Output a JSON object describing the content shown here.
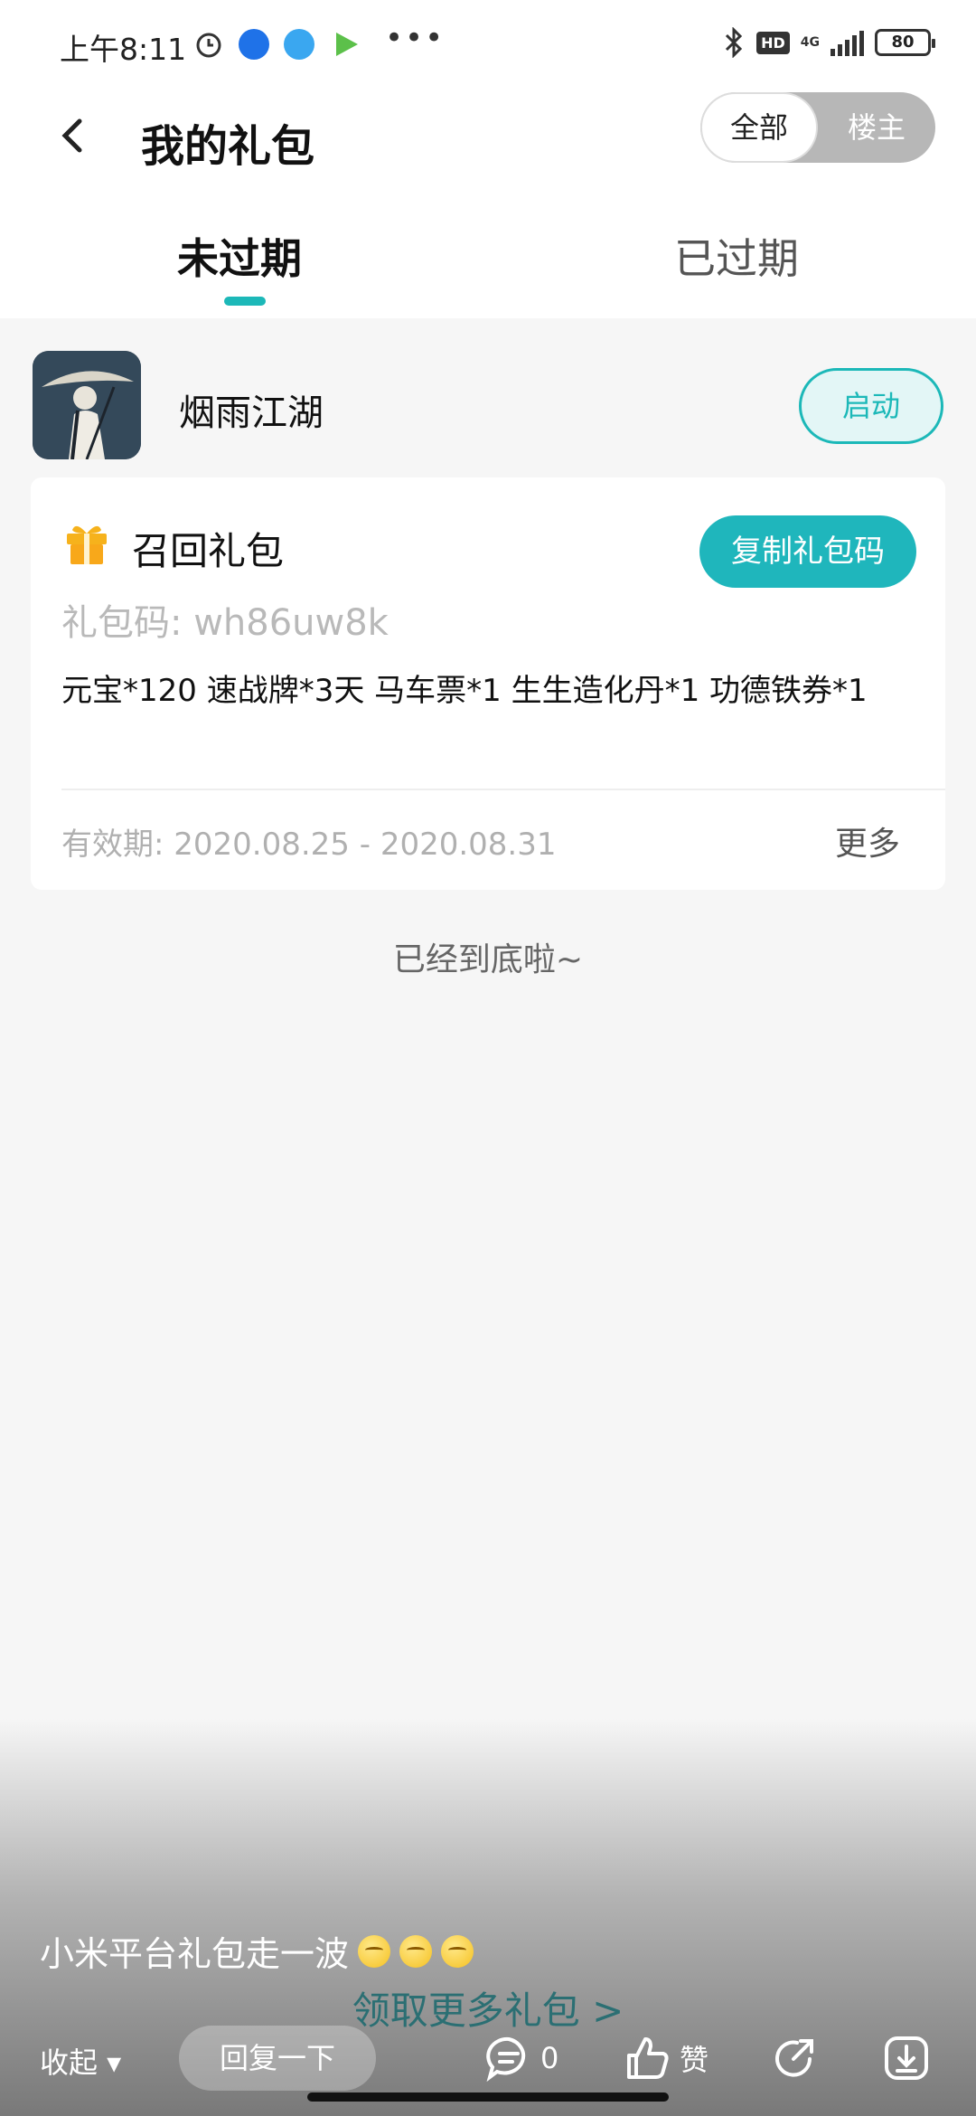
{
  "status_bar": {
    "time": "上午8:11",
    "more": "•••",
    "network": "4G",
    "hd": "HD",
    "battery": "80"
  },
  "header": {
    "title": "我的礼包",
    "toggle": {
      "all_label": "全部",
      "owner_label": "楼主"
    }
  },
  "tabs": [
    {
      "label": "未过期",
      "active": true
    },
    {
      "label": "已过期",
      "active": false
    }
  ],
  "game": {
    "name": "烟雨江湖",
    "launch_label": "启动"
  },
  "gift": {
    "title": "召回礼包",
    "copy_label": "复制礼包码",
    "code": "礼包码: wh86uw8k",
    "contents": "元宝*120 速战牌*3天 马车票*1 生生造化丹*1 功德铁券*1",
    "validity": "有效期: 2020.08.25 - 2020.08.31",
    "more_label": "更多"
  },
  "end_text": "已经到底啦~",
  "post": {
    "caption": "小米平台礼包走一波",
    "emoji_count": 3,
    "more_gifts_link": "领取更多礼包 >",
    "collapse_label": "收起 ▾",
    "reply_placeholder": "回复一下",
    "comment_count": "0",
    "like_label": "赞"
  },
  "colors": {
    "accent": "#1cb8b8",
    "copy_button": "#1fb6bc",
    "link": "#2b6f73"
  }
}
